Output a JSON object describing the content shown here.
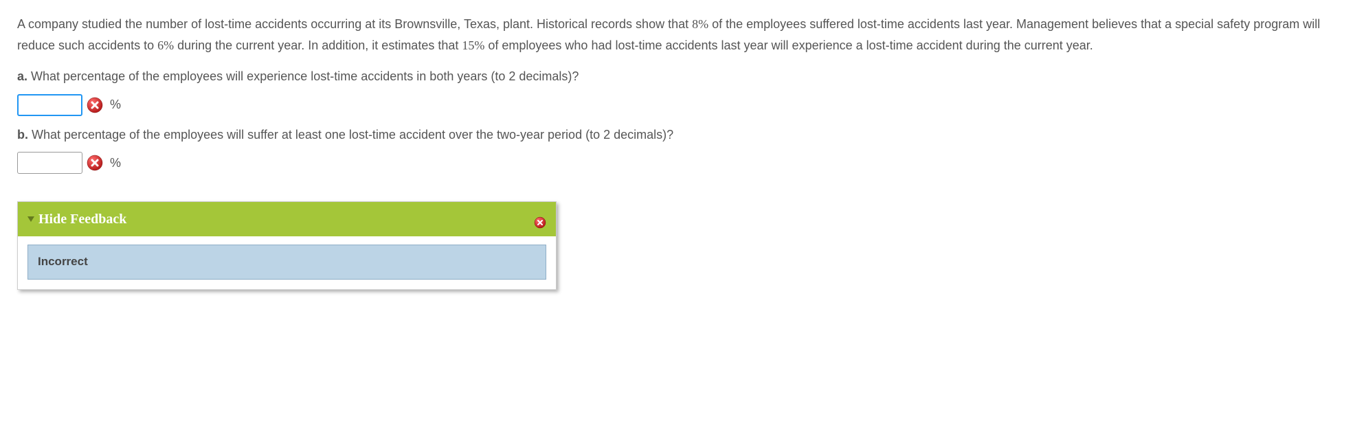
{
  "problem": {
    "text_part1": "A company studied the number of lost-time accidents occurring at its Brownsville, Texas, plant. Historical records show that ",
    "stat1": "8%",
    "text_part2": " of the employees suffered lost-time accidents last year. Management believes that a special safety program will reduce such accidents to ",
    "stat2": "6%",
    "text_part3": " during the current year. In addition, it estimates that ",
    "stat3": "15%",
    "text_part4": " of employees who had lost-time accidents last year will experience a lost-time accident during the current year."
  },
  "questions": {
    "a": {
      "label": "a.",
      "text_part1": " What percentage of the employees will experience lost-time accidents in both years (to ",
      "decimals": "2",
      "text_part2": " decimals)?",
      "value": "",
      "unit": "%"
    },
    "b": {
      "label": "b.",
      "text_part1": " What percentage of the employees will suffer at least one lost-time accident over the two-year period (to ",
      "decimals": "2",
      "text_part2": " decimals)?",
      "value": "",
      "unit": "%"
    }
  },
  "feedback": {
    "header": "Hide Feedback",
    "status": "Incorrect"
  }
}
